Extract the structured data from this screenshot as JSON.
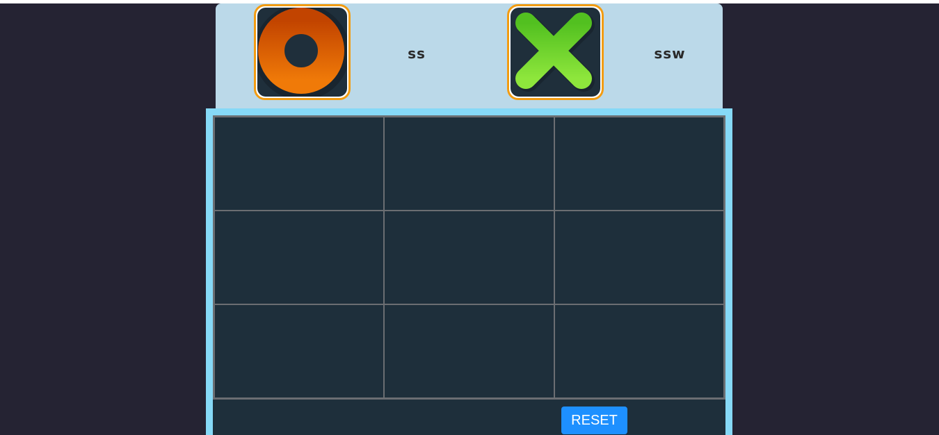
{
  "players": {
    "o": {
      "name": "ss",
      "symbol_icon": "o-ring-icon",
      "accent": "#e86a0a"
    },
    "x": {
      "name": "ssw",
      "symbol_icon": "x-cross-icon",
      "accent": "#7ed62f"
    }
  },
  "board": {
    "rows": 3,
    "cols": 3,
    "cells": [
      "",
      "",
      "",
      "",
      "",
      "",
      "",
      "",
      ""
    ]
  },
  "controls": {
    "reset_label": "RESET"
  },
  "colors": {
    "background": "#252333",
    "panel": "#bbd9e9",
    "board_frame": "#86d9f7",
    "board_cell": "#1e2f3b",
    "active_highlight": "#f39c12",
    "reset_button": "#1e90ff"
  }
}
